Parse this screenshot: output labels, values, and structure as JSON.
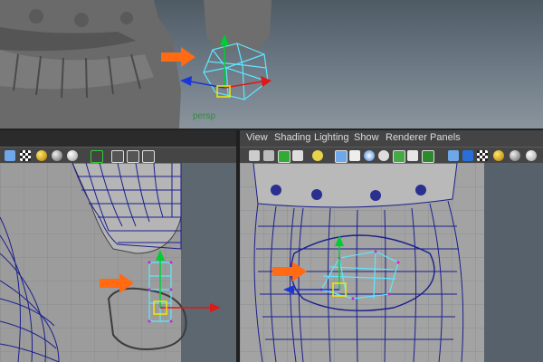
{
  "top_viewport": {
    "camera_label": "persp"
  },
  "panel_menu": {
    "items": [
      {
        "label": "View"
      },
      {
        "label": "Shading"
      },
      {
        "label": "Lighting"
      },
      {
        "label": "Show"
      },
      {
        "label": "Renderer"
      },
      {
        "label": "Panels"
      }
    ]
  },
  "colors": {
    "highlight_orange": "#ff6a13",
    "manip_green": "#00cc33",
    "manip_blue": "#1a35d8",
    "manip_red": "#e01818",
    "select_cyan": "#5fe6ff",
    "wire_blue": "#1a1f8c"
  },
  "icons": {
    "left_toolbar": [
      "cube-icon",
      "checker-icon",
      "shaded-sphere-icon",
      "gray-sphere-icon",
      "light-sphere-icon",
      "select-arrow-icon",
      "frame-icon",
      "cube-outline-icon",
      "copy-icon",
      "node-icon"
    ],
    "right_toolbar": [
      "camera-icon",
      "film-icon",
      "bookmark-icon",
      "grid-icon",
      "light-icon",
      "wireframe-icon",
      "film-strip-icon",
      "sphere-icon",
      "circle-icon",
      "xray-icon",
      "texture-icon",
      "text-icon",
      "cube-icon",
      "cube-solid-icon",
      "checker-icon",
      "bulb-icon",
      "shaded-sphere-icon",
      "light-sphere-icon"
    ]
  }
}
